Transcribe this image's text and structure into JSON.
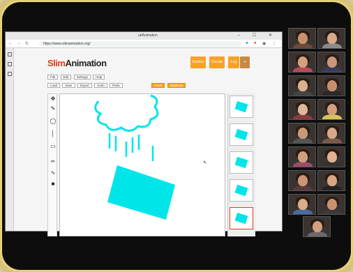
{
  "browser": {
    "tab_title": "ut/Animation",
    "url": "https://www.slimanimation.org/",
    "controls": "–  ☐  ✕"
  },
  "app": {
    "logo_prefix": "Slim",
    "logo_suffix": "Animation",
    "top_buttons": [
      "Gallery",
      "Create",
      "Log"
    ],
    "row1_chips": [
      "File",
      "Edit",
      "Settings",
      "Help"
    ],
    "row2_chips": [
      "Load",
      "Save",
      "Export",
      "Undo",
      "Redo"
    ],
    "row2_actions": [
      "Insert",
      "Duplicate"
    ],
    "tools": [
      "✥",
      "✎",
      "◯",
      "│",
      "▭",
      "✂",
      "∿",
      "■"
    ],
    "frame_count": 5
  },
  "colors": {
    "accent": "#f7a125",
    "brand_red": "#e53a1c",
    "drawing": "#00e5e8"
  },
  "participants": [
    {
      "name": "",
      "skin": "#c9926b",
      "shirt": "#6a4a3a"
    },
    {
      "name": "",
      "skin": "#d6a98a",
      "shirt": "#8a8a8a"
    },
    {
      "name": "",
      "skin": "#d3a17c",
      "shirt": "#b84a5a"
    },
    {
      "name": "",
      "skin": "#c8987a",
      "shirt": "#3b3b5b"
    },
    {
      "name": "",
      "skin": "#dab08e",
      "shirt": "#444"
    },
    {
      "name": "",
      "skin": "#c49070",
      "shirt": "#2a2a2a"
    },
    {
      "name": "",
      "skin": "#e0b598",
      "shirt": "#8b3b3b"
    },
    {
      "name": "",
      "skin": "#d2a07e",
      "shirt": "#d8c25a"
    },
    {
      "name": "",
      "skin": "#c99a7a",
      "shirt": "#555"
    },
    {
      "name": "",
      "skin": "#d8a888",
      "shirt": "#7a5a4a"
    },
    {
      "name": "",
      "skin": "#cfa07f",
      "shirt": "#a14a6a"
    },
    {
      "name": "",
      "skin": "#e0b090",
      "shirt": "#333"
    },
    {
      "name": "",
      "skin": "#c89674",
      "shirt": "#5a3a3a"
    },
    {
      "name": "",
      "skin": "#d6a584",
      "shirt": "#222"
    },
    {
      "name": "",
      "skin": "#d9ad8d",
      "shirt": "#4a6aa0"
    },
    {
      "name": "",
      "skin": "#c7936f",
      "shirt": "#3a3a3a"
    },
    {
      "name": "",
      "skin": "#d0a080",
      "shirt": "#6a6a6a"
    }
  ]
}
